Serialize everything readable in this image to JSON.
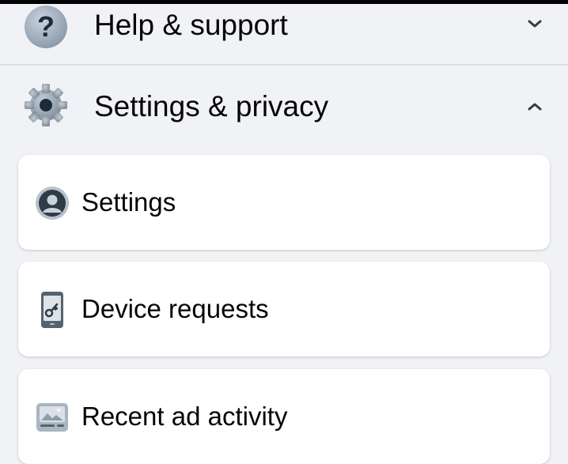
{
  "sections": {
    "help": {
      "label": "Help & support",
      "icon": "help-icon",
      "state": "collapsed"
    },
    "settings_privacy": {
      "label": "Settings & privacy",
      "icon": "gear-icon",
      "state": "expanded",
      "items": [
        {
          "label": "Settings",
          "icon": "profile-circle-icon"
        },
        {
          "label": "Device requests",
          "icon": "phone-key-icon"
        },
        {
          "label": "Recent ad activity",
          "icon": "ad-activity-icon"
        }
      ]
    }
  },
  "colors": {
    "background": "#F0F2F5",
    "card": "#FFFFFF",
    "text": "#050505",
    "icon_gray": "#8A9199",
    "icon_dark": "#3E4A55",
    "divider": "#DADDE1"
  }
}
